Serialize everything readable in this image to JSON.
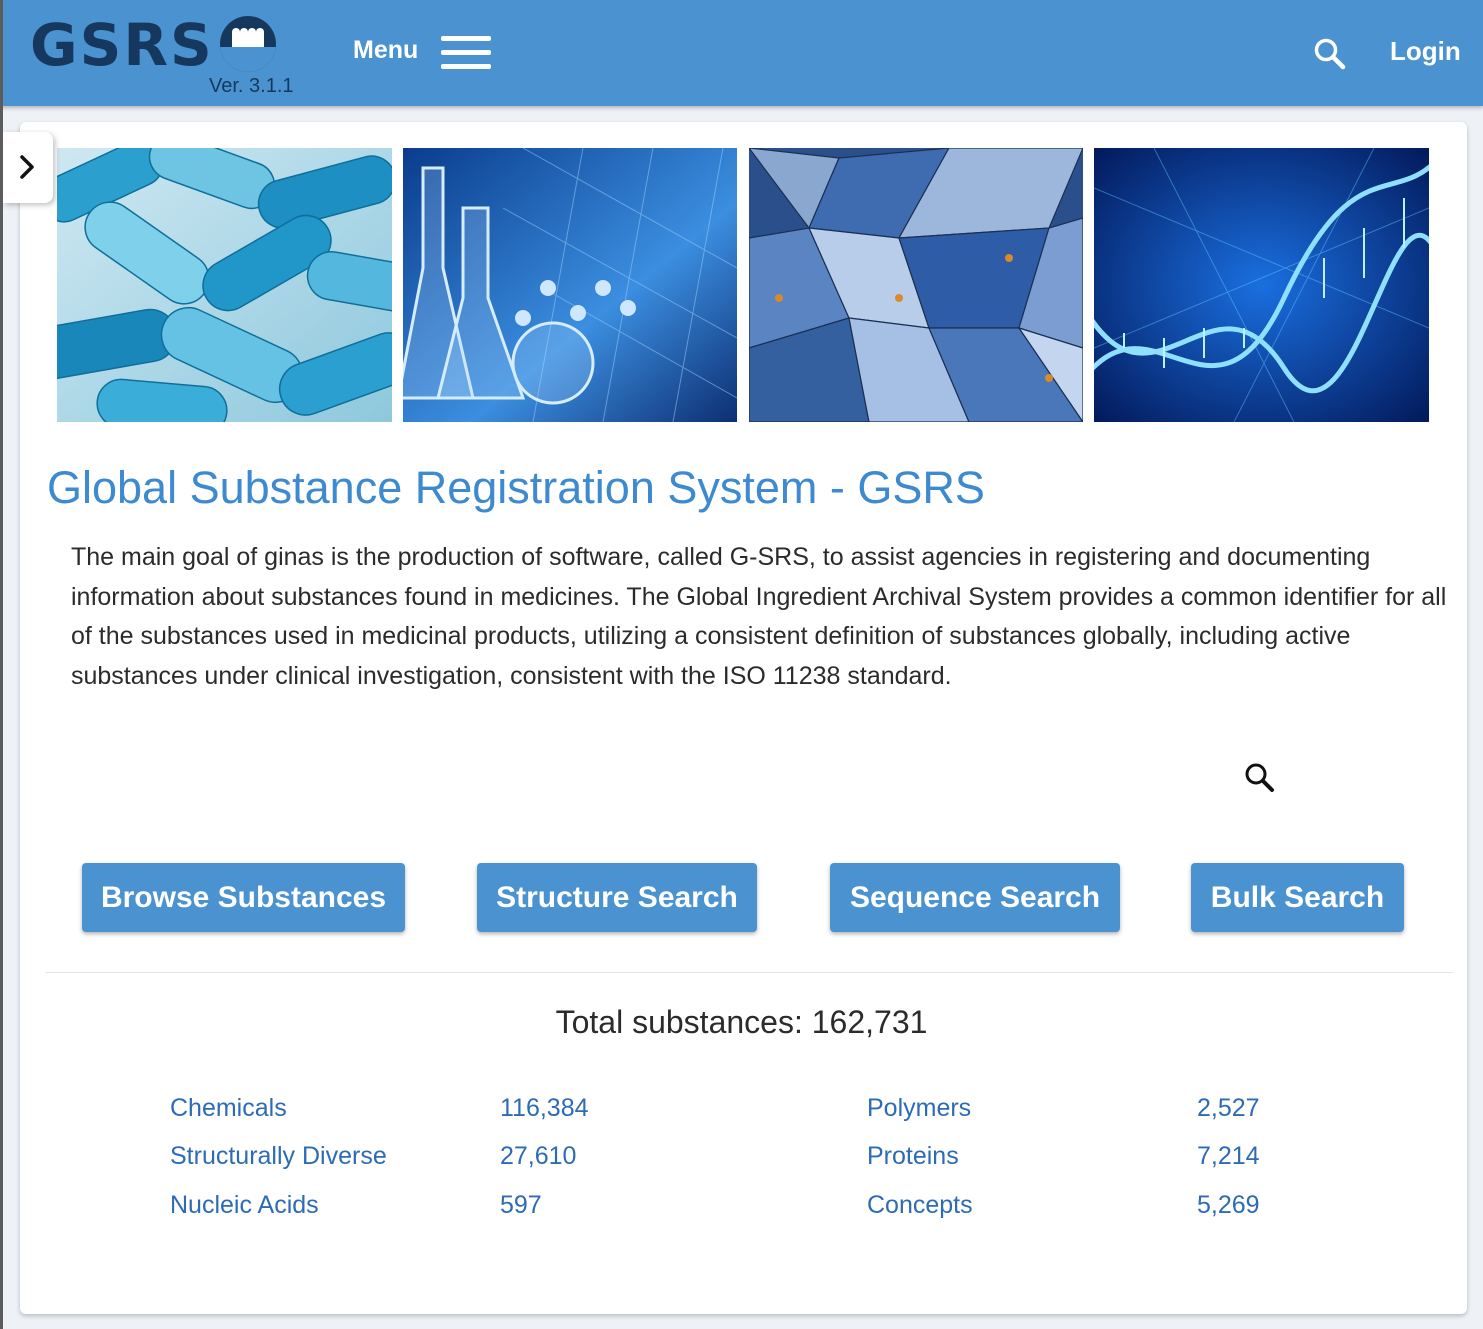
{
  "header": {
    "logo_text": "GSRS",
    "version": "Ver. 3.1.1",
    "menu_label": "Menu",
    "login_label": "Login",
    "background_color": "#4a92d0"
  },
  "hero_images": [
    "capsules-image",
    "periodic-table-glassware-image",
    "blue-petals-image",
    "dna-helix-image"
  ],
  "main": {
    "title": "Global Substance Registration System - GSRS",
    "description": "The main goal of ginas is the production of software, called G-SRS, to assist agencies in registering and documenting information about substances found in medicines. The Global Ingredient Archival System provides a common identifier for all of the substances used in medicinal products, utilizing a consistent definition of substances globally, including active substances under clinical investigation, consistent with the ISO 11238 standard."
  },
  "buttons": {
    "browse": "Browse Substances",
    "structure": "Structure Search",
    "sequence": "Sequence Search",
    "bulk": "Bulk Search"
  },
  "stats": {
    "total_label": "Total substances:",
    "total_value": "162,731",
    "items": [
      {
        "label": "Chemicals",
        "value": "116,384"
      },
      {
        "label": "Structurally Diverse",
        "value": "27,610"
      },
      {
        "label": "Nucleic Acids",
        "value": "597"
      },
      {
        "label": "Polymers",
        "value": "2,527"
      },
      {
        "label": "Proteins",
        "value": "7,214"
      },
      {
        "label": "Concepts",
        "value": "5,269"
      }
    ]
  },
  "colors": {
    "accent": "#4a92d0",
    "title": "#3d8ad0",
    "link": "#2d6bb5",
    "logo": "#17385e"
  }
}
